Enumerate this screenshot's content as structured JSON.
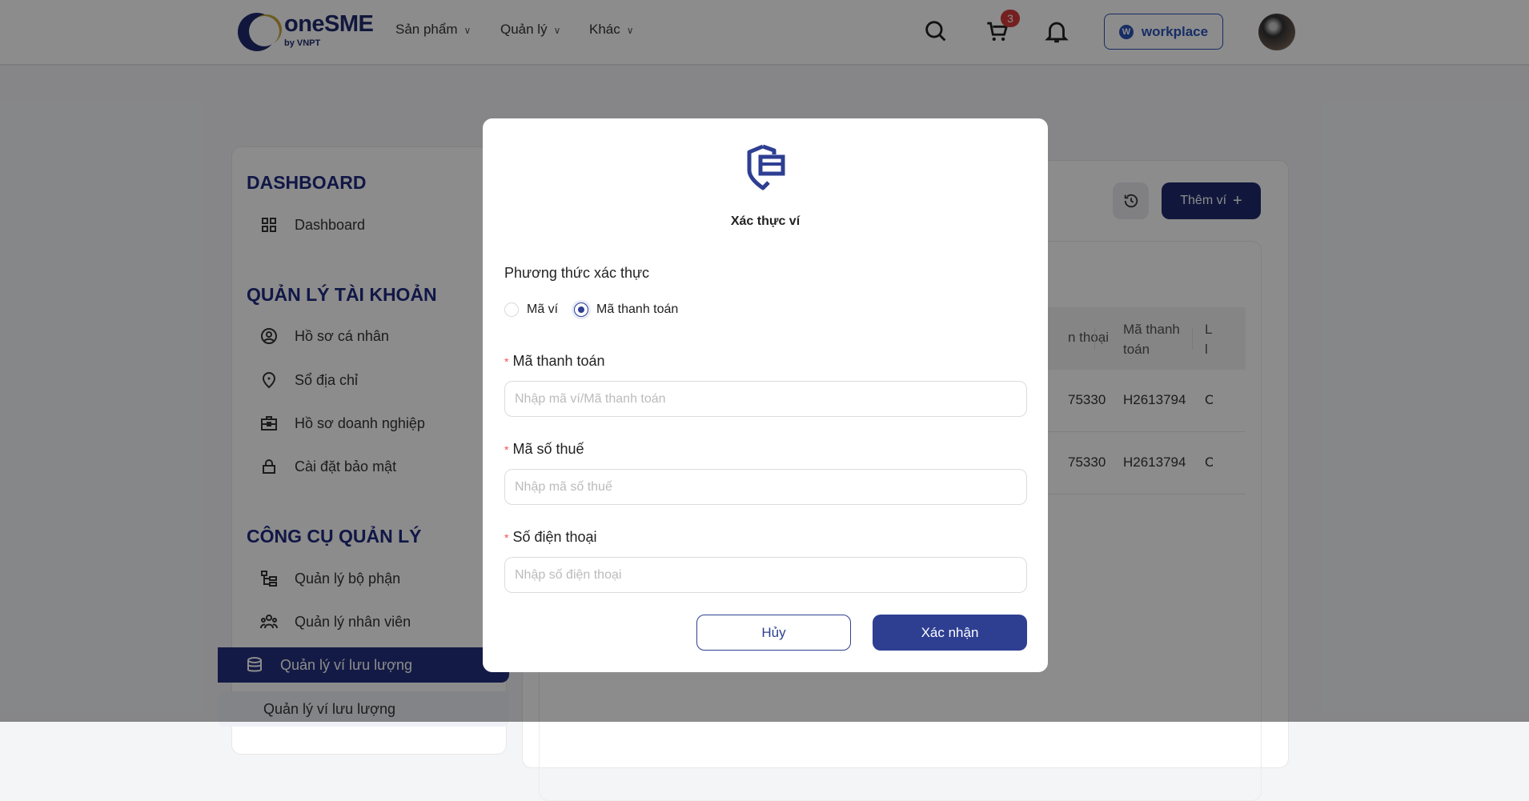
{
  "header": {
    "logo": {
      "brand": "oneSME",
      "sub": "by VNPT"
    },
    "nav": [
      {
        "label": "Sản phẩm"
      },
      {
        "label": "Quản lý"
      },
      {
        "label": "Khác"
      }
    ],
    "cart_count": "3",
    "workplace_label": "workplace",
    "icons": [
      "search-icon",
      "cart-icon",
      "bell-icon"
    ]
  },
  "sidebar": {
    "sections": [
      {
        "title": "DASHBOARD",
        "items": [
          {
            "label": "Dashboard"
          }
        ]
      },
      {
        "title": "QUẢN LÝ TÀI KHOẢN",
        "items": [
          {
            "label": "Hồ sơ cá nhân"
          },
          {
            "label": "Sổ địa chỉ"
          },
          {
            "label": "Hồ sơ doanh nghiệp"
          },
          {
            "label": "Cài đặt bảo mật"
          }
        ]
      },
      {
        "title": "CÔNG CỤ QUẢN LÝ",
        "items": [
          {
            "label": "Quản lý bộ phận"
          },
          {
            "label": "Quản lý nhân viên"
          },
          {
            "label": "Quản lý ví lưu lượng",
            "active": true
          }
        ]
      }
    ],
    "sub_item": "Quản lý ví lưu lượng"
  },
  "main": {
    "add_wallet_label": "Thêm ví",
    "table": {
      "columns": [
        "n thoại",
        "Mã thanh toán",
        "L l"
      ],
      "rows": [
        [
          "75330",
          "H2613794",
          "C"
        ],
        [
          "75330",
          "H2613794",
          "C"
        ]
      ]
    }
  },
  "modal": {
    "title": "Xác thực ví",
    "method_label": "Phương thức xác thực",
    "options": [
      {
        "label": "Mã ví",
        "selected": false
      },
      {
        "label": "Mã thanh toán",
        "selected": true
      }
    ],
    "fields": [
      {
        "label": "Mã thanh toán",
        "placeholder": "Nhập mã ví/Mã thanh toán",
        "value": ""
      },
      {
        "label": "Mã số thuế",
        "placeholder": "Nhập mã số thuế",
        "value": ""
      },
      {
        "label": "Số điện thoại",
        "placeholder": "Nhập số điện thoại",
        "value": ""
      }
    ],
    "cancel_label": "Hủy",
    "confirm_label": "Xác nhận"
  },
  "colors": {
    "primary": "#2e3f92",
    "navy": "#1f2a6e",
    "badge": "#d63b3b",
    "required": "#ff4d4f"
  }
}
